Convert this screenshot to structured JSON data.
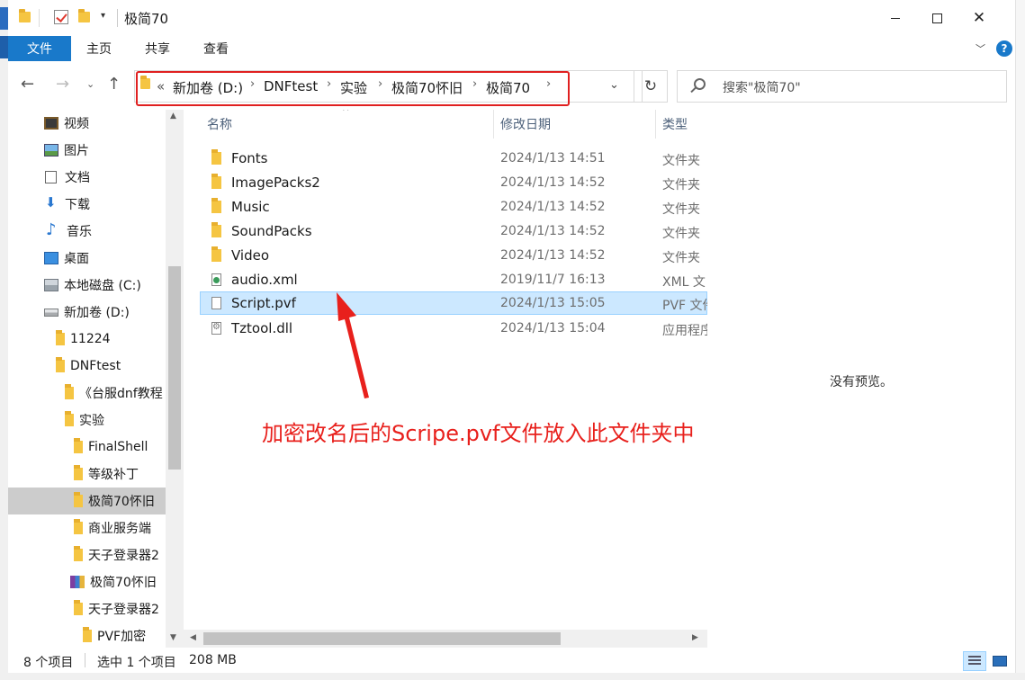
{
  "window": {
    "title": "极简70",
    "icons": [
      "folder-icon",
      "check-icon",
      "folder-icon",
      "chevron-down-icon"
    ]
  },
  "ribbon": {
    "tabs": [
      {
        "label": "文件"
      },
      {
        "label": "主页"
      },
      {
        "label": "共享"
      },
      {
        "label": "查看"
      }
    ],
    "help_glyph": "?"
  },
  "address": {
    "overflow": "«",
    "crumbs": [
      {
        "label": "新加卷 (D:)"
      },
      {
        "label": "DNFtest"
      },
      {
        "label": "实验"
      },
      {
        "label": "极简70怀旧"
      },
      {
        "label": "极简70"
      }
    ],
    "highlight_color": "#e02020"
  },
  "search": {
    "placeholder": "搜索\"极简70\""
  },
  "sidebar": {
    "items": [
      {
        "label": "视频",
        "icon": "video-icon"
      },
      {
        "label": "图片",
        "icon": "picture-icon"
      },
      {
        "label": "文档",
        "icon": "document-icon"
      },
      {
        "label": "下载",
        "icon": "download-icon"
      },
      {
        "label": "音乐",
        "icon": "music-icon"
      },
      {
        "label": "桌面",
        "icon": "desktop-icon"
      },
      {
        "label": "本地磁盘 (C:)",
        "icon": "drive-icon"
      },
      {
        "label": "新加卷 (D:)",
        "icon": "drive-icon"
      },
      {
        "label": "11224",
        "icon": "folder-icon"
      },
      {
        "label": "DNFtest",
        "icon": "folder-icon"
      },
      {
        "label": "《台服dnf教程",
        "icon": "folder-icon"
      },
      {
        "label": "实验",
        "icon": "folder-icon"
      },
      {
        "label": "FinalShell",
        "icon": "folder-icon"
      },
      {
        "label": "等级补丁",
        "icon": "folder-icon"
      },
      {
        "label": "极简70怀旧",
        "icon": "folder-icon",
        "selected": true
      },
      {
        "label": "商业服务端",
        "icon": "folder-icon"
      },
      {
        "label": "天子登录器2",
        "icon": "folder-icon"
      },
      {
        "label": "极简70怀旧",
        "icon": "archive-icon"
      },
      {
        "label": "天子登录器2",
        "icon": "folder-icon"
      },
      {
        "label": "PVF加密",
        "icon": "folder-icon"
      }
    ]
  },
  "filelist": {
    "columns": [
      {
        "label": "名称"
      },
      {
        "label": "修改日期"
      },
      {
        "label": "类型"
      }
    ],
    "rows": [
      {
        "name": "Fonts",
        "date": "2024/1/13 14:51",
        "type": "文件夹",
        "icon": "folder-icon"
      },
      {
        "name": "ImagePacks2",
        "date": "2024/1/13 14:52",
        "type": "文件夹",
        "icon": "folder-icon"
      },
      {
        "name": "Music",
        "date": "2024/1/13 14:52",
        "type": "文件夹",
        "icon": "folder-icon"
      },
      {
        "name": "SoundPacks",
        "date": "2024/1/13 14:52",
        "type": "文件夹",
        "icon": "folder-icon"
      },
      {
        "name": "Video",
        "date": "2024/1/13 14:52",
        "type": "文件夹",
        "icon": "folder-icon"
      },
      {
        "name": "audio.xml",
        "date": "2019/11/7 16:13",
        "type": "XML 文",
        "icon": "xml-file-icon"
      },
      {
        "name": "Script.pvf",
        "date": "2024/1/13 15:05",
        "type": "PVF 文件",
        "icon": "file-icon",
        "selected": true
      },
      {
        "name": "Tztool.dll",
        "date": "2024/1/13 15:04",
        "type": "应用程序",
        "icon": "dll-file-icon"
      }
    ]
  },
  "preview": {
    "text": "没有预览。"
  },
  "annotation": {
    "text": "加密改名后的Scripe.pvf文件放入此文件夹中",
    "color": "#e8201c"
  },
  "status": {
    "item_count": "8 个项目",
    "selection": "选中 1 个项目",
    "size": "208 MB"
  },
  "colors": {
    "accent": "#1979ca",
    "selection": "#cce8ff",
    "sidebar_selected": "#cccccc"
  }
}
